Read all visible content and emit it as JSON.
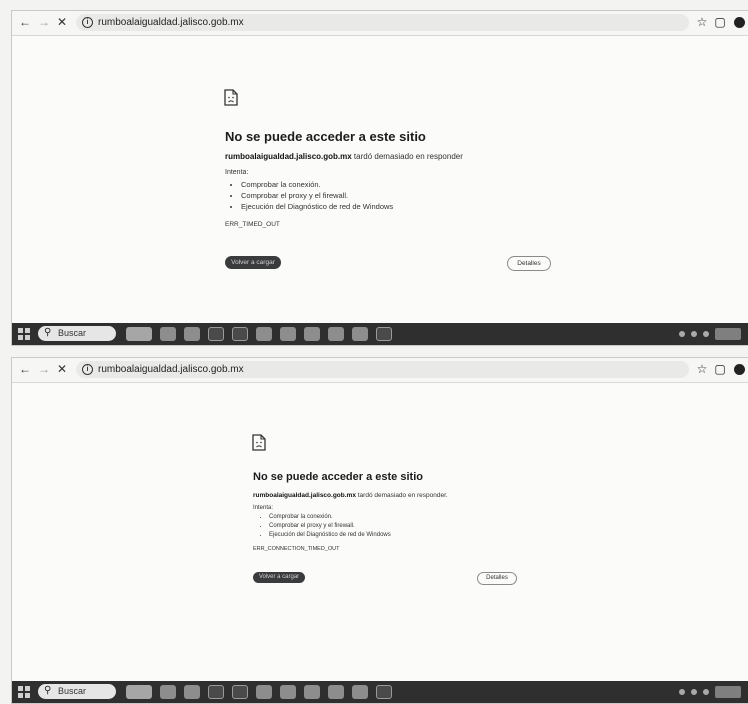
{
  "shot1": {
    "url": "rumboalaigualdad.jalisco.gob.mx",
    "title": "No se puede acceder a este sitio",
    "host": "rumboalaigualdad.jalisco.gob.mx",
    "host_suffix": " tardó demasiado en responder",
    "try_label": "Intenta:",
    "suggestions": [
      "Comprobar la conexión.",
      "Comprobar el proxy y el firewall.",
      "Ejecución del Diagnóstico de red de Windows"
    ],
    "error_code": "ERR_TIMED_OUT",
    "reload_label": "Volver a cargar",
    "details_label": "Detalles",
    "search_label": "Buscar"
  },
  "shot2": {
    "url": "rumboalaigualdad.jalisco.gob.mx",
    "title": "No se puede acceder a este sitio",
    "host": "rumboalaigualdad.jalisco.gob.mx",
    "host_suffix": " tardó demasiado en responder.",
    "try_label": "Intenta:",
    "suggestions": [
      "Comprobar la conexión.",
      "Comprobar el proxy y el firewall.",
      "Ejecución del Diagnóstico de red de Windows"
    ],
    "error_code": "ERR_CONNECTION_TIMED_OUT",
    "reload_label": "Volver a cargar",
    "details_label": "Detalles",
    "search_label": "Buscar"
  },
  "icons": {
    "back": "arrow-left",
    "forward": "arrow-right",
    "stop": "close-x",
    "site_info": "info-circle",
    "bookmark": "star",
    "extensions": "puzzle",
    "profile": "avatar-circle",
    "error_page": "sad-document",
    "start": "windows-grid",
    "search": "magnifier"
  }
}
